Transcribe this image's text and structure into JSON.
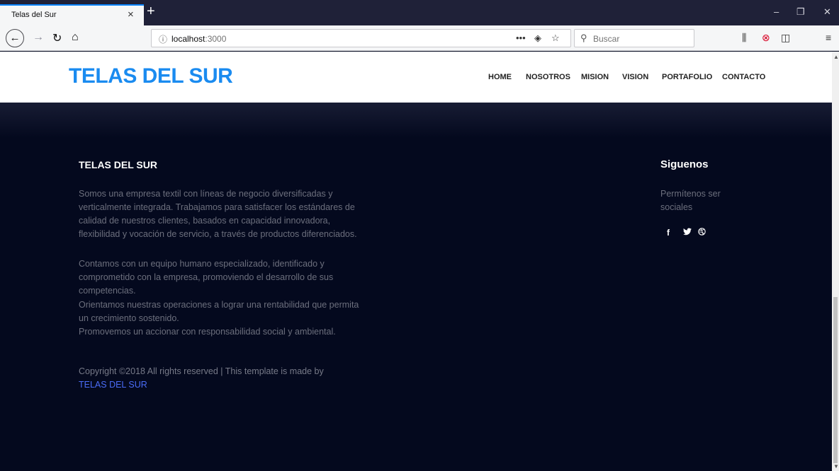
{
  "browser": {
    "tab_title": "Telas del Sur",
    "tab_close": "×",
    "new_tab": "+",
    "url_host": "localhost",
    "url_port": ":3000",
    "search_placeholder": "Buscar",
    "minimize": "–",
    "restore": "❐",
    "close": "✕"
  },
  "header": {
    "logo": "TELAS DEL SUR",
    "menu": [
      "HOME",
      "NOSOTROS",
      "MISION",
      "VISION",
      "PORTAFOLIO",
      "CONTACTO"
    ]
  },
  "footer": {
    "about_title": "TELAS DEL SUR",
    "paragraphs": [
      "Somos una empresa textil con líneas de negocio diversificadas y verticalmente integrada. Trabajamos para satisfacer los estándares de calidad de nuestros clientes, basados en capacidad innovadora, flexibilidad y vocación de servicio, a través de productos diferenciados.",
      "Contamos con un equipo humano especializado, identificado y comprometido con la empresa, promoviendo el desarrollo de sus competencias.",
      "Orientamos nuestras operaciones a lograr una rentabilidad que permita un crecimiento sostenido.",
      "Promovemos un accionar con responsabilidad social y ambiental."
    ],
    "copyright": "Copyright ©2018 All rights reserved | This template is made by",
    "copyright_link": "TELAS DEL SUR",
    "social_title": "Siguenos",
    "social_text": "Permítenos ser sociales",
    "social_icons": [
      "facebook-icon",
      "twitter-icon",
      "dribbble-icon"
    ]
  }
}
